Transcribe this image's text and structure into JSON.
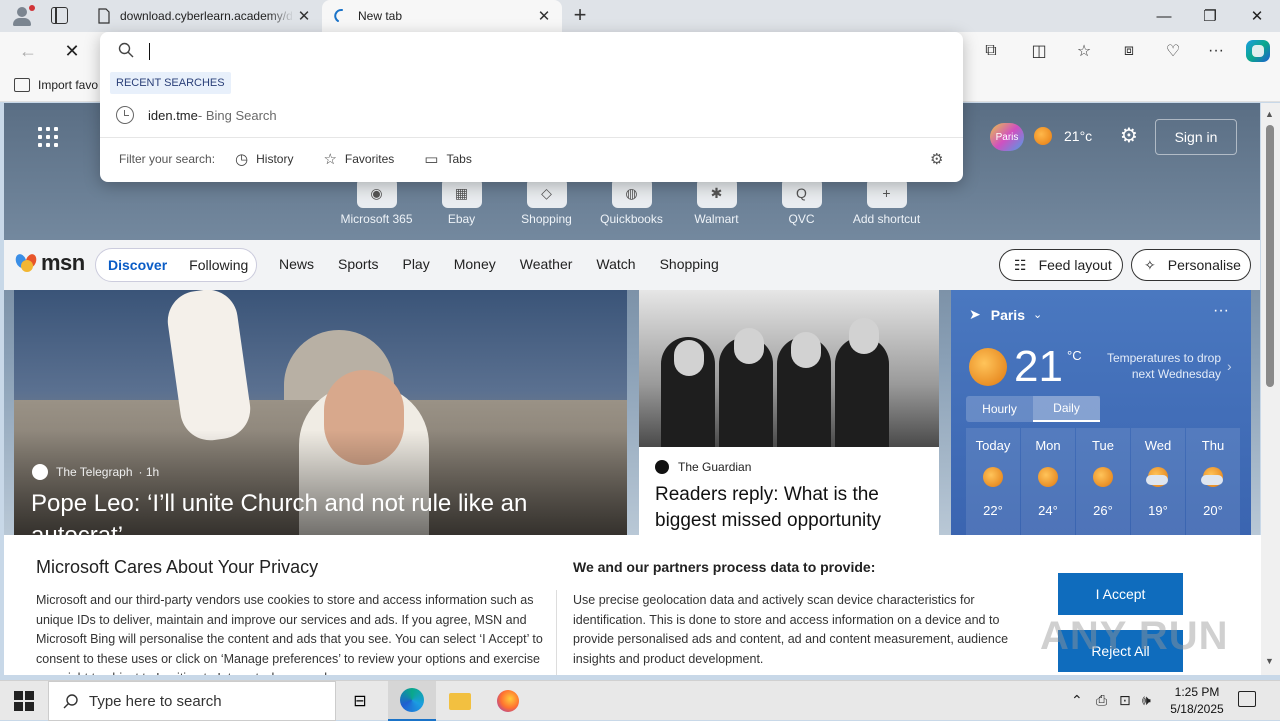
{
  "browser": {
    "tabs": [
      {
        "title": "download.cyberlearn.academy/d",
        "active": false
      },
      {
        "title": "New tab",
        "active": true
      }
    ],
    "favorites_bar": {
      "import_label": "Import favo"
    }
  },
  "omnibox": {
    "value": "",
    "recent_label": "RECENT SEARCHES",
    "suggestion": {
      "text": "iden.tme",
      "sub": " - Bing Search"
    },
    "filter_label": "Filter your search:",
    "filters": [
      {
        "label": "History",
        "icon": "history-icon"
      },
      {
        "label": "Favorites",
        "icon": "star-icon"
      },
      {
        "label": "Tabs",
        "icon": "tabs-icon"
      }
    ]
  },
  "newtab": {
    "badge_text": "Paris",
    "weather_small": "21°c",
    "signin_label": "Sign in",
    "shortcuts": [
      {
        "label": "Microsoft 365",
        "glyph": "◉"
      },
      {
        "label": "Ebay",
        "glyph": "▦"
      },
      {
        "label": "Shopping",
        "glyph": "◇"
      },
      {
        "label": "Quickbooks",
        "glyph": "◍"
      },
      {
        "label": "Walmart",
        "glyph": "✱"
      },
      {
        "label": "QVC",
        "glyph": "Q"
      },
      {
        "label": "Add shortcut",
        "glyph": "+"
      }
    ]
  },
  "msn": {
    "logo": "msn",
    "pill_tabs": [
      "Discover",
      "Following"
    ],
    "nav": [
      "News",
      "Sports",
      "Play",
      "Money",
      "Weather",
      "Watch",
      "Shopping"
    ],
    "feed_layout_label": "Feed layout",
    "personalise_label": "Personalise"
  },
  "cards": {
    "hero": {
      "source": "The Telegraph",
      "age": "· 1h",
      "headline": "Pope Leo: ‘I’ll unite Church and not rule like an autocrat’"
    },
    "second": {
      "source": "The Guardian",
      "headline": "Readers reply: What is the biggest missed opportunity"
    },
    "weather": {
      "location": "Paris",
      "temp": "21",
      "unit": "°C",
      "note": "Temperatures to drop next Wednesday",
      "modes": [
        "Hourly",
        "Daily"
      ],
      "days": [
        {
          "name": "Today",
          "temp": "22°",
          "icon": "sun"
        },
        {
          "name": "Mon",
          "temp": "24°",
          "icon": "sun"
        },
        {
          "name": "Tue",
          "temp": "26°",
          "icon": "sun"
        },
        {
          "name": "Wed",
          "temp": "19°",
          "icon": "cloudy"
        },
        {
          "name": "Thu",
          "temp": "20°",
          "icon": "partly-cloudy"
        }
      ]
    }
  },
  "privacy": {
    "title": "Microsoft Cares About Your Privacy",
    "body": "Microsoft and our third-party vendors use cookies to store and access information such as unique IDs to deliver, maintain and improve our services and ads. If you agree, MSN and Microsoft Bing will personalise the content and ads that you see. You can select ‘I Accept’ to consent to these uses or click on ‘Manage preferences’ to review your options and exercise your right to object to Legitimate Interest where used.",
    "partners_title": "We and our partners process data to provide:",
    "partners_body": "Use precise geolocation data and actively scan device characteristics for identification. This is done to store and access information on a device and to provide personalised ads and content, ad and content measurement, audience insights and product development.",
    "accept_label": "I Accept",
    "reject_label": "Reject All"
  },
  "watermark": "ANY RUN",
  "taskbar": {
    "search_placeholder": "Type here to search",
    "time": "1:25 PM",
    "date": "5/18/2025"
  }
}
